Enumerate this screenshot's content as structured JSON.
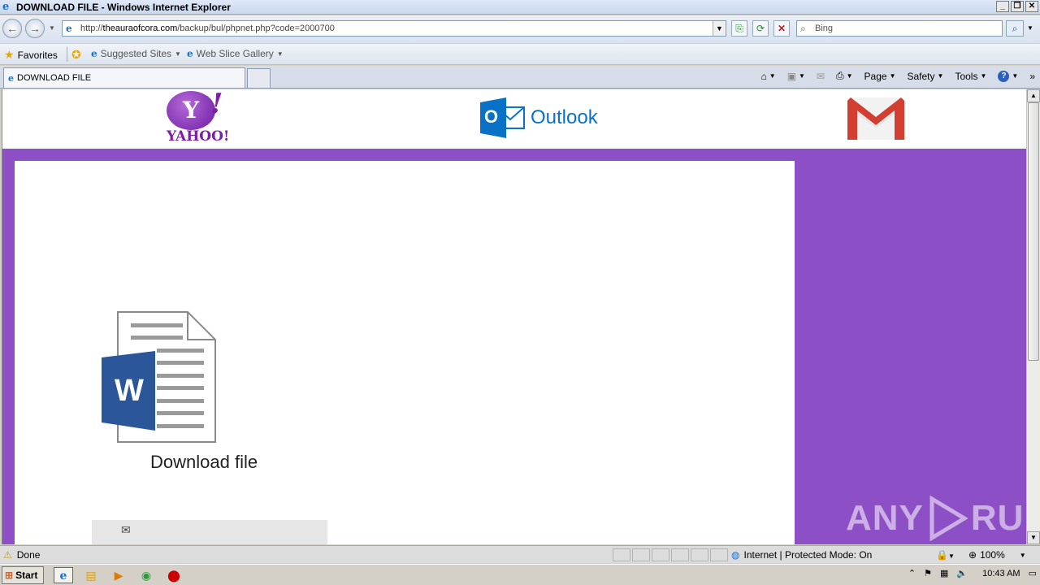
{
  "window": {
    "title": "DOWNLOAD FILE - Windows Internet Explorer"
  },
  "address": {
    "url_prefix": "http://",
    "url_domain": "theauraofcora.com",
    "url_path": "/backup/bul/phpnet.php?code=2000700"
  },
  "search": {
    "placeholder": "Bing"
  },
  "favorites_bar": {
    "favorites": "Favorites",
    "suggested": "Suggested Sites",
    "webslice": "Web Slice Gallery"
  },
  "tab": {
    "title": "DOWNLOAD FILE"
  },
  "commands": {
    "page": "Page",
    "safety": "Safety",
    "tools": "Tools"
  },
  "page": {
    "yahoo_letter": "Y",
    "yahoo_excl": "!",
    "yahoo_word": "YAHOO!",
    "outlook_letter": "O",
    "outlook_word": "Outlook",
    "word_letter": "W",
    "download_label": "Download file"
  },
  "watermark": {
    "left": "ANY",
    "right": "RUN"
  },
  "status": {
    "text": "Done",
    "zone": "Internet | Protected Mode: On",
    "zoom": "100%"
  },
  "taskbar": {
    "start": "Start",
    "time": "10:43 AM"
  },
  "colors": {
    "purple": "#8c4fc6",
    "outlook_blue": "#0a72c6",
    "word_blue": "#2b579a",
    "gmail_red": "#d23f31"
  }
}
